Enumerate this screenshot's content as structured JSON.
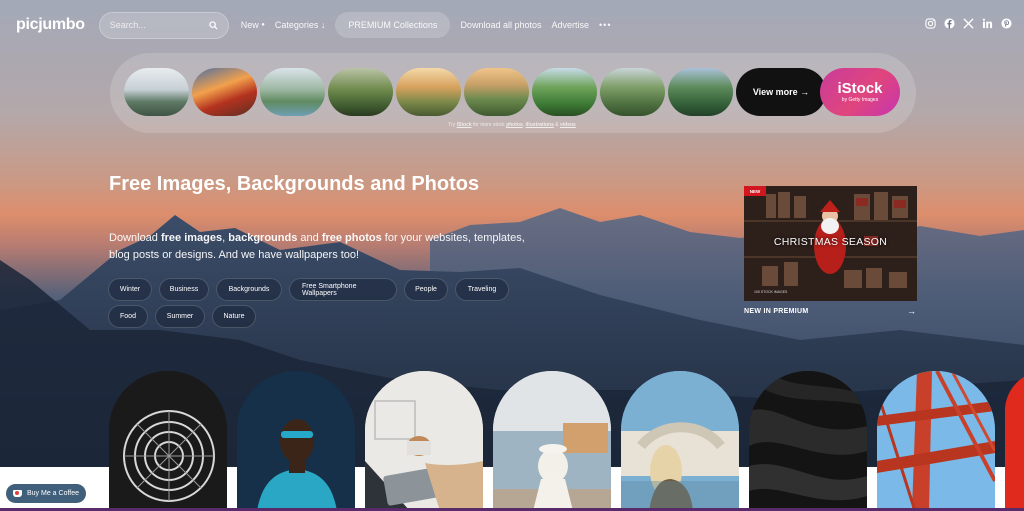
{
  "header": {
    "logo": "picjumbo",
    "search_placeholder": "Search...",
    "nav": {
      "new": "New",
      "categories": "Categories ↓",
      "premium": "PREMIUM Collections",
      "download_all": "Download all photos",
      "advertise": "Advertise",
      "more": "•••"
    },
    "socials": [
      "instagram-icon",
      "facebook-icon",
      "x-icon",
      "linkedin-icon",
      "pinterest-icon"
    ]
  },
  "carousel": {
    "view_more": "View more →",
    "istock_brand": "iStock",
    "istock_sub": "by Getty Images",
    "try_prefix": "Try",
    "try_brand": "iStock",
    "try_middle": "for more stock",
    "try_photos": "photos",
    "try_illustrations": "illustrations",
    "try_and": "&",
    "try_videos": "videos"
  },
  "hero": {
    "title": "Free Images, Backgrounds and Photos",
    "desc_1": "Download ",
    "desc_b1": "free images",
    "desc_2": ", ",
    "desc_b2": "backgrounds",
    "desc_3": " and ",
    "desc_b3": "free photos",
    "desc_4": " for your websites, templates, blog posts or designs. And we have wallpapers too!",
    "tags": [
      "Winter",
      "Business",
      "Backgrounds",
      "Free Smartphone Wallpapers",
      "People",
      "Traveling",
      "Food",
      "Summer",
      "Nature"
    ]
  },
  "promo": {
    "badge": "NEW",
    "banner": "CHRISTMAS SEASON",
    "small": "100 STOCK IMAGES",
    "label": "NEW IN PREMIUM",
    "arrow": "→"
  },
  "coffee": {
    "label": "Buy Me a Coffee"
  },
  "colors": {
    "accent": "#e0457d",
    "coffee_button": "#405f7b"
  }
}
